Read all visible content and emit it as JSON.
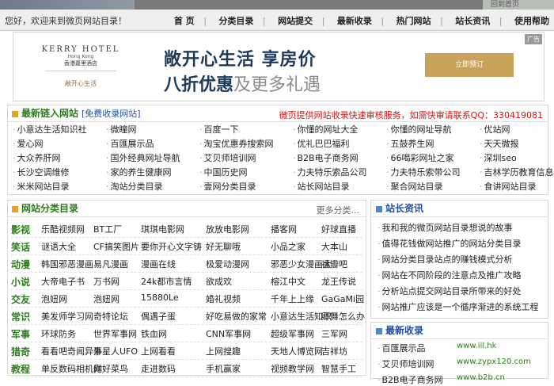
{
  "top_strip": {
    "right_text": "回到首页"
  },
  "topbar": {
    "welcome": "您好，欢迎来到微页网站目录！",
    "nav": [
      "首 页",
      "分类目录",
      "网站提交",
      "最新收录",
      "热门网站",
      "站长资讯",
      "使用帮助"
    ]
  },
  "banner": {
    "logo_brand": "KERRY HOTEL",
    "logo_city": "Hong Kong",
    "logo_cn": "香港嘉里酒店",
    "logo_slogan": "敞开心生活",
    "line1": "敞开心生活   享房价",
    "line2_strong": "八折优惠",
    "line2_light": "及更多礼遇",
    "button": "立即预订",
    "ad_tag": "广告"
  },
  "latest": {
    "title": "最新链入网站",
    "link": "[免费收录网站]",
    "notice": "微页提供网站收录快速审核服务，如需快审请联系QQ：330419081",
    "rows": [
      [
        "小意达生活知识社",
        "微瞳网",
        "百度一下",
        "你懂的网址大全",
        "你懂的网址导航",
        "优站网"
      ],
      [
        "爱心网",
        "百匯展示品",
        "淘宝优惠券搜索网",
        "优礼巴巴福利",
        "五鼓养生网",
        "天天微报"
      ],
      [
        "大众养肝网",
        "国外经典网址导航",
        "艾贝师培训网",
        "B2B电子商务网",
        "66喝彩网址之家",
        "深圳seo"
      ],
      [
        "长沙空调维修",
        "家的养生健康网",
        "中国历史网",
        "力夫特乐索品公司",
        "力夫特乐索带公司",
        "吉林学历教育信息"
      ],
      [
        "米米网站目录",
        "淘站分类目录",
        "壹网分类目录",
        "站长网站目录",
        "聚合网站目录",
        "食讲网站目录"
      ]
    ]
  },
  "categories": {
    "title": "网站分类目录",
    "more": "更多分类...",
    "rows": [
      {
        "cat": "影视",
        "items": [
          "乐酷视频网",
          "BT工厂",
          "琪琪电影网",
          "放放电影网",
          "播客网",
          "好球直播"
        ]
      },
      {
        "cat": "笑话",
        "items": [
          "谜语大全",
          "CF搞笑图片",
          "要你开心文字铸",
          "好无聊哦",
          "小品之家",
          "大本山"
        ]
      },
      {
        "cat": "动漫",
        "items": [
          "韩国邪恶漫画",
          "易凡漫画",
          "漫画在线",
          "极爱动漫网",
          "邪恶少女漫画大",
          "福瓣吧"
        ]
      },
      {
        "cat": "小说",
        "items": [
          "大帝电子书",
          "万书网",
          "24k都市言情",
          "欲成欢",
          "榕江中文",
          "龙王传说"
        ]
      },
      {
        "cat": "交友",
        "items": [
          "泡妞网",
          "泡妞网",
          "15880Le",
          "婚礼视频",
          "千年上上缘",
          "GaGaMi园"
        ]
      },
      {
        "cat": "常识",
        "items": [
          "美发师学习网",
          "奇特论坛",
          "偶遇子蛋",
          "好吃易做的家常",
          "小意达生活知识",
          "卿舞怎么办"
        ]
      },
      {
        "cat": "军事",
        "items": [
          "环球防务",
          "世界军事网",
          "铁血网",
          "CNN军事网",
          "超级军事网",
          "三军网"
        ]
      },
      {
        "cat": "猎奇",
        "items": [
          "看看吧奇闻异事",
          "外星人UFO",
          "上网看看",
          "上网搜趣",
          "天地人博览网",
          "吉祥坊"
        ]
      },
      {
        "cat": "教程",
        "items": [
          "单反数码相机网",
          "你好菜鸟",
          "走进数码",
          "手机赢家",
          "视频教学网",
          "智慧手工"
        ]
      }
    ]
  },
  "news": {
    "title": "站长资讯",
    "items": [
      "我和我的微页网站目录想说的故事",
      "值得花钱做网站推广的网站分类目录",
      "网站分类目录站点的赚钱模式分析",
      "网站在不同阶段的注意点及推广攻略",
      "分析站点提交网站目录所带来的好处",
      "网站推广应该是一个循序渐进的系统工程"
    ]
  },
  "recent": {
    "title": "最新收录",
    "items": [
      {
        "name": "百匯展示品",
        "url": "www.iil.hk"
      },
      {
        "name": "艾贝师培训网",
        "url": "www.zypx120.com"
      },
      {
        "name": "B2B电子商务网",
        "url": "www.b2b.cn"
      }
    ]
  }
}
